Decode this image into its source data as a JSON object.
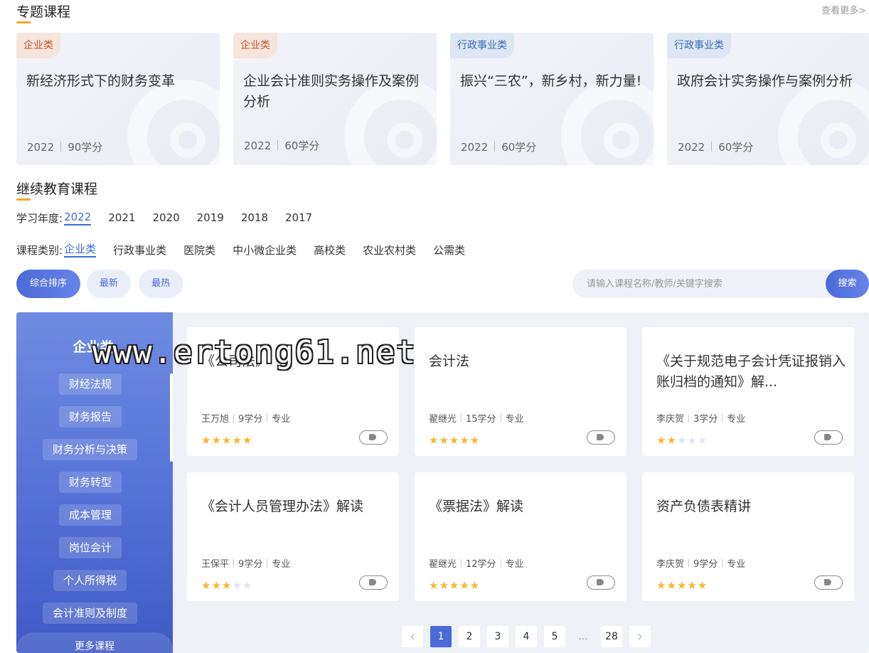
{
  "topic_section": {
    "title": "专题课程",
    "more": "查看更多>",
    "cards": [
      {
        "tag": "企业类",
        "title": "新经济形式下的财务变革",
        "year": "2022",
        "credits": "90学分"
      },
      {
        "tag": "企业类",
        "title": "企业会计准则实务操作及案例分析",
        "year": "2022",
        "credits": "60学分"
      },
      {
        "tag": "行政事业类",
        "title": "振兴“三农”，新乡村，新力量!",
        "year": "2022",
        "credits": "60学分"
      },
      {
        "tag": "行政事业类",
        "title": "政府会计实务操作与案例分析",
        "year": "2022",
        "credits": "60学分"
      }
    ]
  },
  "edu_section": {
    "title": "继续教育课程",
    "year_label": "学习年度:",
    "years": [
      "2022",
      "2021",
      "2020",
      "2019",
      "2018",
      "2017"
    ],
    "category_label": "课程类别:",
    "categories": [
      "企业类",
      "行政事业类",
      "医院类",
      "中小微企业类",
      "高校类",
      "农业农村类",
      "公需类"
    ]
  },
  "sort": {
    "comprehensive": "综合排序",
    "latest": "最新",
    "hottest": "最热"
  },
  "search": {
    "placeholder": "请输入课程名称/教师/关键字搜索",
    "button": "搜索"
  },
  "sidebar": {
    "title": "企业类",
    "items": [
      "财经法规",
      "财务报告",
      "财务分析与决策",
      "财务转型",
      "成本管理",
      "岗位会计",
      "个人所得税",
      "会计准则及制度"
    ],
    "more": "更多课程"
  },
  "courses": [
    {
      "title": "《公司法》",
      "teacher": "王万旭",
      "credits": "9学分",
      "type": "专业",
      "rating": 5
    },
    {
      "title": "会计法",
      "teacher": "翟继光",
      "credits": "15学分",
      "type": "专业",
      "rating": 5
    },
    {
      "title": "《关于规范电子会计凭证报销入账归档的通知》解...",
      "teacher": "李庆贺",
      "credits": "3学分",
      "type": "专业",
      "rating": 2
    },
    {
      "title": "《会计人员管理办法》解读",
      "teacher": "王保平",
      "credits": "9学分",
      "type": "专业",
      "rating": 3
    },
    {
      "title": "《票据法》解读",
      "teacher": "翟继光",
      "credits": "12学分",
      "type": "专业",
      "rating": 5
    },
    {
      "title": "资产负债表精讲",
      "teacher": "李庆贺",
      "credits": "9学分",
      "type": "专业",
      "rating": 5
    }
  ],
  "pagination": {
    "pages": [
      "1",
      "2",
      "3",
      "4",
      "5"
    ],
    "ellipsis": "...",
    "last": "28",
    "prev": "‹",
    "next": "›"
  },
  "watermark": "www.ertong61.net"
}
